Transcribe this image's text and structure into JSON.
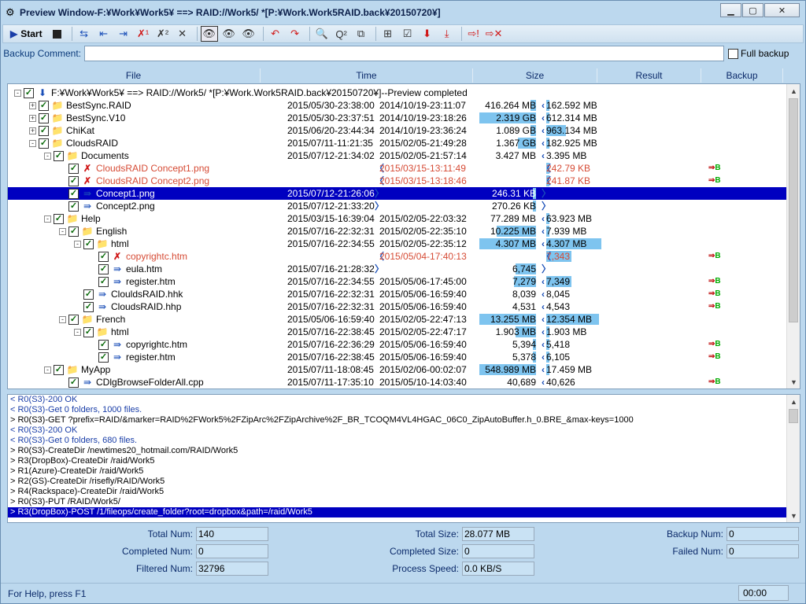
{
  "window": {
    "title": "Preview Window-F:¥Work¥Work5¥ ==> RAID://Work5/ *[P:¥Work.Work5RAID.back¥20150720¥]"
  },
  "toolbar": {
    "start_label": "Start"
  },
  "comment": {
    "label": "Backup Comment:",
    "value": "",
    "full_backup_label": "Full backup"
  },
  "columns": {
    "file": "File",
    "time": "Time",
    "size": "Size",
    "result": "Result",
    "backup": "Backup"
  },
  "tree": [
    {
      "name": "F:¥Work¥Work5¥ ==> RAID://Work5/ *[P:¥Work.Work5RAID.back¥20150720¥]--Preview completed",
      "level": 0,
      "exp": "-",
      "type": "root",
      "t1": "",
      "t2": "",
      "s1": "",
      "s2": "",
      "b1": 0,
      "b2": 0,
      "backup": false,
      "red": false
    },
    {
      "name": "BestSync.RAID",
      "level": 1,
      "exp": "+",
      "type": "folder",
      "t1": "2015/05/30-23:38:00",
      "t2": "2014/10/19-23:11:07",
      "s1": "416.264 MB",
      "s2": "162.592 MB",
      "b1": 0.1,
      "b2": 0.06,
      "backup": false,
      "red": false
    },
    {
      "name": "BestSync.V10",
      "level": 1,
      "exp": "+",
      "type": "folder",
      "t1": "2015/05/30-23:37:51",
      "t2": "2014/10/19-23:18:26",
      "s1": "2.319 GB",
      "s2": "612.314 MB",
      "b1": 0.99,
      "b2": 0.06,
      "backup": false,
      "red": false
    },
    {
      "name": "ChiKat",
      "level": 1,
      "exp": "+",
      "type": "folder",
      "t1": "2015/06/20-23:44:34",
      "t2": "2014/10/19-23:36:24",
      "s1": "1.089 GB",
      "s2": "963.134 MB",
      "b1": 0.1,
      "b2": 0.35,
      "backup": false,
      "red": false
    },
    {
      "name": "CloudsRAID",
      "level": 1,
      "exp": "-",
      "type": "folder",
      "t1": "2015/07/11-11:21:35",
      "t2": "2015/02/05-21:49:28",
      "s1": "1.367 GB",
      "s2": "182.925 MB",
      "b1": 0.32,
      "b2": 0.06,
      "backup": false,
      "red": false
    },
    {
      "name": "Documents",
      "level": 2,
      "exp": "-",
      "type": "folder",
      "t1": "2015/07/12-21:34:02",
      "t2": "2015/02/05-21:57:14",
      "s1": "3.427 MB",
      "s2": "3.395 MB",
      "b1": 0,
      "b2": 0,
      "backup": false,
      "red": false
    },
    {
      "name": "CloudsRAID Concept1.png",
      "level": 3,
      "exp": "",
      "type": "xfile",
      "t1": "",
      "t2": "2015/03/15-13:11:49",
      "s1": "",
      "s2": "242.79 KB",
      "b1": 0,
      "b2": 0.06,
      "backup": true,
      "red": true,
      "lt1": true,
      "lt2": true
    },
    {
      "name": "CloudsRAID Concept2.png",
      "level": 3,
      "exp": "",
      "type": "xfile",
      "t1": "",
      "t2": "2015/03/15-13:18:46",
      "s1": "",
      "s2": "241.87 KB",
      "b1": 0,
      "b2": 0.06,
      "backup": true,
      "red": true,
      "lt1": true,
      "lt2": true
    },
    {
      "name": "Concept1.png",
      "level": 3,
      "exp": "",
      "type": "file",
      "t1": "2015/07/12-21:26:06",
      "t2": "",
      "s1": "246.31 KB",
      "s2": "",
      "b1": 0.06,
      "b2": 0,
      "backup": false,
      "red": false,
      "sel": true,
      "gt1": true,
      "gt2": true
    },
    {
      "name": "Concept2.png",
      "level": 3,
      "exp": "",
      "type": "file",
      "t1": "2015/07/12-21:33:20",
      "t2": "",
      "s1": "270.26 KB",
      "s2": "",
      "b1": 0.06,
      "b2": 0,
      "backup": false,
      "red": false,
      "gt1": true,
      "gt2": true
    },
    {
      "name": "Help",
      "level": 2,
      "exp": "-",
      "type": "folder",
      "t1": "2015/03/15-16:39:04",
      "t2": "2015/02/05-22:03:32",
      "s1": "77.289 MB",
      "s2": "63.923 MB",
      "b1": 0,
      "b2": 0.06,
      "backup": false,
      "red": false
    },
    {
      "name": "English",
      "level": 3,
      "exp": "-",
      "type": "folder",
      "t1": "2015/07/16-22:32:31",
      "t2": "2015/02/05-22:35:10",
      "s1": "10.225 MB",
      "s2": "7.939 MB",
      "b1": 0.68,
      "b2": 0.06,
      "backup": false,
      "red": false
    },
    {
      "name": "html",
      "level": 4,
      "exp": "-",
      "type": "folder",
      "t1": "2015/07/16-22:34:55",
      "t2": "2015/02/05-22:35:12",
      "s1": "4.307 MB",
      "s2": "4.307 MB",
      "b1": 0.99,
      "b2": 1.0,
      "backup": false,
      "red": false
    },
    {
      "name": "copyrightc.htm",
      "level": 5,
      "exp": "",
      "type": "xfile",
      "t1": "",
      "t2": "2015/05/04-17:40:13",
      "s1": "",
      "s2": "7,343",
      "b1": 0,
      "b2": 0.45,
      "backup": true,
      "red": true,
      "lt1": true,
      "lt2": true
    },
    {
      "name": "eula.htm",
      "level": 5,
      "exp": "",
      "type": "file",
      "t1": "2015/07/16-21:28:32",
      "t2": "",
      "s1": "6,745",
      "s2": "",
      "b1": 0.35,
      "b2": 0,
      "backup": false,
      "red": false,
      "gt1": true,
      "gt2": true
    },
    {
      "name": "register.htm",
      "level": 5,
      "exp": "",
      "type": "file",
      "t1": "2015/07/16-22:34:55",
      "t2": "2015/05/06-17:45:00",
      "s1": "7,279",
      "s2": "7,349",
      "b1": 0.38,
      "b2": 0.45,
      "backup": true,
      "red": false
    },
    {
      "name": "ClouldsRAID.hhk",
      "level": 4,
      "exp": "",
      "type": "file",
      "t1": "2015/07/16-22:32:31",
      "t2": "2015/05/06-16:59:40",
      "s1": "8,039",
      "s2": "8,045",
      "b1": 0,
      "b2": 0,
      "backup": true,
      "red": false
    },
    {
      "name": "CloudsRAID.hhp",
      "level": 4,
      "exp": "",
      "type": "file",
      "t1": "2015/07/16-22:32:31",
      "t2": "2015/05/06-16:59:40",
      "s1": "4,531",
      "s2": "4,543",
      "b1": 0,
      "b2": 0,
      "backup": true,
      "red": false
    },
    {
      "name": "French",
      "level": 3,
      "exp": "-",
      "type": "folder",
      "t1": "2015/05/06-16:59:40",
      "t2": "2015/02/05-22:47:13",
      "s1": "13.255 MB",
      "s2": "12.354 MB",
      "b1": 0.99,
      "b2": 0.96,
      "backup": false,
      "red": false
    },
    {
      "name": "html",
      "level": 4,
      "exp": "-",
      "type": "folder",
      "t1": "2015/07/16-22:38:45",
      "t2": "2015/02/05-22:47:17",
      "s1": "1.903 MB",
      "s2": "1.903 MB",
      "b1": 0.35,
      "b2": 0.06,
      "backup": false,
      "red": false
    },
    {
      "name": "copyrightc.htm",
      "level": 5,
      "exp": "",
      "type": "file",
      "t1": "2015/07/16-22:36:29",
      "t2": "2015/05/06-16:59:40",
      "s1": "5,394",
      "s2": "5,418",
      "b1": 0.06,
      "b2": 0.06,
      "backup": true,
      "red": false
    },
    {
      "name": "register.htm",
      "level": 5,
      "exp": "",
      "type": "file",
      "t1": "2015/07/16-22:38:45",
      "t2": "2015/05/06-16:59:40",
      "s1": "5,378",
      "s2": "6,105",
      "b1": 0.06,
      "b2": 0.06,
      "backup": true,
      "red": false
    },
    {
      "name": "MyApp",
      "level": 2,
      "exp": "-",
      "type": "folder",
      "t1": "2015/07/11-18:08:45",
      "t2": "2015/02/06-00:02:07",
      "s1": "548.989 MB",
      "s2": "17.459 MB",
      "b1": 0.99,
      "b2": 0.06,
      "backup": false,
      "red": false
    },
    {
      "name": "CDlgBrowseFolderAll.cpp",
      "level": 3,
      "exp": "",
      "type": "file",
      "t1": "2015/07/11-17:35:10",
      "t2": "2015/05/10-14:03:40",
      "s1": "40,689",
      "s2": "40,626",
      "b1": 0,
      "b2": 0,
      "backup": true,
      "red": false
    }
  ],
  "log": [
    {
      "text": "< R0(S3)-200 OK",
      "blue": true
    },
    {
      "text": "< R0(S3)-Get 0 folders, 1000 files.",
      "blue": true
    },
    {
      "text": "> R0(S3)-GET ?prefix=RAID/&marker=RAID%2FWork5%2FZipArc%2FZipArchive%2F_BR_TCOQM4VL4HGAC_06C0_ZipAutoBuffer.h_0.BRE_&max-keys=1000",
      "blue": false
    },
    {
      "text": "< R0(S3)-200 OK",
      "blue": true
    },
    {
      "text": "< R0(S3)-Get 0 folders, 680 files.",
      "blue": true
    },
    {
      "text": "> R0(S3)-CreateDir /newtimes20_hotmail.com/RAID/Work5",
      "blue": false
    },
    {
      "text": "> R3(DropBox)-CreateDir /raid/Work5",
      "blue": false
    },
    {
      "text": "> R1(Azure)-CreateDir /raid/Work5",
      "blue": false
    },
    {
      "text": "> R2(GS)-CreateDir /risefly/RAID/Work5",
      "blue": false
    },
    {
      "text": "> R4(Rackspace)-CreateDir /raid/Work5",
      "blue": false
    },
    {
      "text": "> R0(S3)-PUT /RAID/Work5/",
      "blue": false
    },
    {
      "text": "> R3(DropBox)-POST /1/fileops/create_folder?root=dropbox&path=/raid/Work5",
      "blue": false,
      "sel": true
    }
  ],
  "stats": {
    "total_num_label": "Total Num:",
    "total_num": "140",
    "completed_num_label": "Completed Num:",
    "completed_num": "0",
    "filtered_num_label": "Filtered Num:",
    "filtered_num": "32796",
    "total_size_label": "Total Size:",
    "total_size": "28.077 MB",
    "completed_size_label": "Completed Size:",
    "completed_size": "0",
    "process_speed_label": "Process Speed:",
    "process_speed": "0.0 KB/S",
    "backup_num_label": "Backup Num:",
    "backup_num": "0",
    "failed_num_label": "Failed Num:",
    "failed_num": "0"
  },
  "status": {
    "message": "For Help, press F1",
    "clock": "00:00"
  }
}
